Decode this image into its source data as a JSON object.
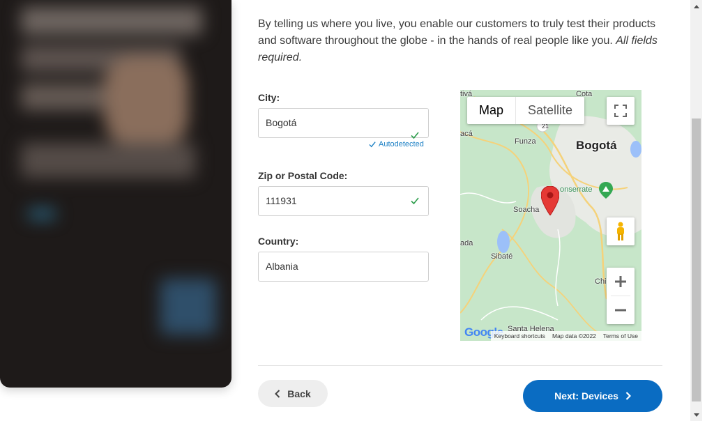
{
  "intro": {
    "text": "By telling us where you live, you enable our customers to truly test their products and software throughout the globe - in the hands of real people like you.",
    "emphasis": "All fields required."
  },
  "form": {
    "city": {
      "label": "City:",
      "value": "Bogotá",
      "status": "Autodetected"
    },
    "zip": {
      "label": "Zip or Postal Code:",
      "value": "111931"
    },
    "country": {
      "label": "Country:",
      "value": "Albania"
    }
  },
  "map": {
    "type_map": "Map",
    "type_satellite": "Satellite",
    "labels": {
      "bogota": "Bogotá",
      "funza": "Funza",
      "soacha": "Soacha",
      "monserrate": "onserrate",
      "sibate": "Sibaté",
      "santa_helena": "Santa Helena",
      "ada": "ada",
      "aca": "acá",
      "tiva": "tivá",
      "cota": "Cota",
      "chi": "Chi",
      "route": "21"
    },
    "footer": {
      "shortcuts": "Keyboard shortcuts",
      "data": "Map data ©2022",
      "terms": "Terms of Use"
    },
    "logo": "Google",
    "icons": [
      "fullscreen-icon",
      "pegman-icon",
      "zoom-in-icon",
      "zoom-out-icon",
      "map-pin-icon"
    ]
  },
  "nav": {
    "back": "Back",
    "next": "Next: Devices"
  },
  "colors": {
    "primary": "#0a6cc2",
    "check": "#2e9e4d",
    "link": "#1a7fc4",
    "pin": "#e53935"
  }
}
